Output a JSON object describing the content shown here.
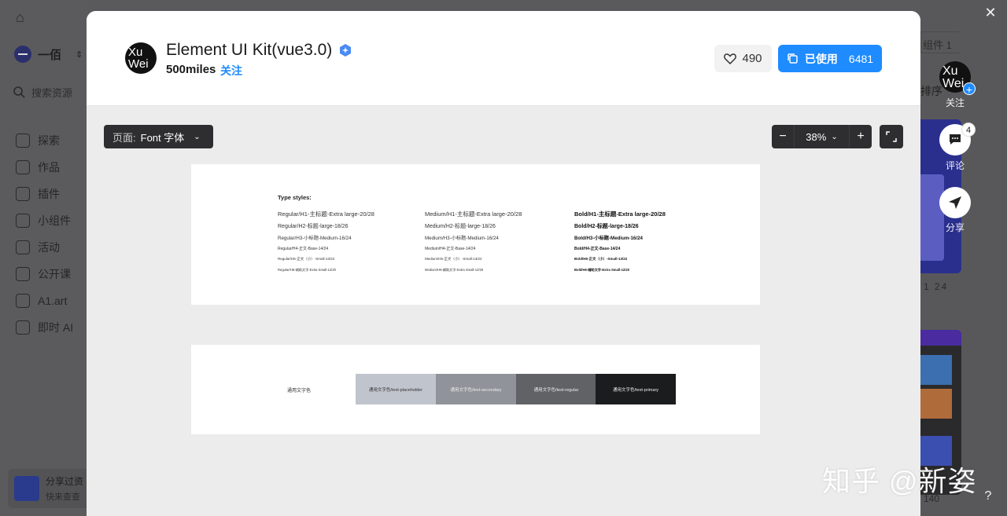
{
  "background": {
    "team_name": "一佰",
    "search_placeholder": "搜索资源",
    "nav": [
      "探索",
      "作品",
      "插件",
      "小组件",
      "活动",
      "公开课",
      "A1.art",
      "即时 AI"
    ],
    "share_title": "分享过资",
    "share_sub": "快来查查",
    "chip_label": "组件 1",
    "sort_label": "排序",
    "card1_stats": "1 24",
    "card2_stats": "140"
  },
  "right_rail": {
    "follow_label": "关注",
    "comment_label": "评论",
    "comment_count": "4",
    "share_label": "分享"
  },
  "header": {
    "avatar_line1": "Xu",
    "avatar_line2": "Wei",
    "title": "Element UI Kit(vue3.0)",
    "author": "500miles",
    "follow": "关注",
    "likes": "490",
    "used_label": "已使用",
    "used_count": "6481"
  },
  "toolbar": {
    "page_label": "页面:",
    "page_value": "Font 字体",
    "zoom_value": "38%"
  },
  "type_styles": {
    "heading": "Type styles:",
    "regular": [
      "Regular/H1-主标题-Extra large-20/28",
      "Regular/H2-标题-large-18/26",
      "Regular/H3-小标题-Medium-16/24",
      "Regular/H4-正文-Base-14/24",
      "Regular/H5-正文（小）-Small-13/22",
      "Regular/H6-辅助文字-Extra Small-12/20"
    ],
    "medium": [
      "Medium/H1-主标题-Extra large-20/28",
      "Medium/H2-标题-large-18/26",
      "Medium/H3-小标题-Medium-16/24",
      "Medium/H4-正文-Base-14/24",
      "Medium/H5-正文（小）-Small-13/22",
      "Medium/H6-辅助文字-Extra Small-12/20"
    ],
    "bold": [
      "Bold/H1-主标题-Extra large-20/28",
      "Bold/H2-标题-large-18/26",
      "Bold/H3-小标题-Medium-16/24",
      "Bold/H4-正文-Base-14/24",
      "Bold/H5-正文（小）-Small-13/22",
      "Bold/H6-辅助文字-Extra Small-12/20"
    ]
  },
  "colors": {
    "label": "通用文字色",
    "swatches": [
      {
        "label": "通用文字色/text-placeholder",
        "color": "#c0c4cc",
        "text_color": "#333333"
      },
      {
        "label": "通用文字色/text-secondary",
        "color": "#909399",
        "text_color": "#eeeeee"
      },
      {
        "label": "通用文字色/text-regular",
        "color": "#606266",
        "text_color": "#eeeeee"
      },
      {
        "label": "通用文字色/text-primary",
        "color": "#1b1c1d",
        "text_color": "#eeeeee"
      }
    ]
  },
  "watermark": "知乎 @新姿",
  "help": "?"
}
